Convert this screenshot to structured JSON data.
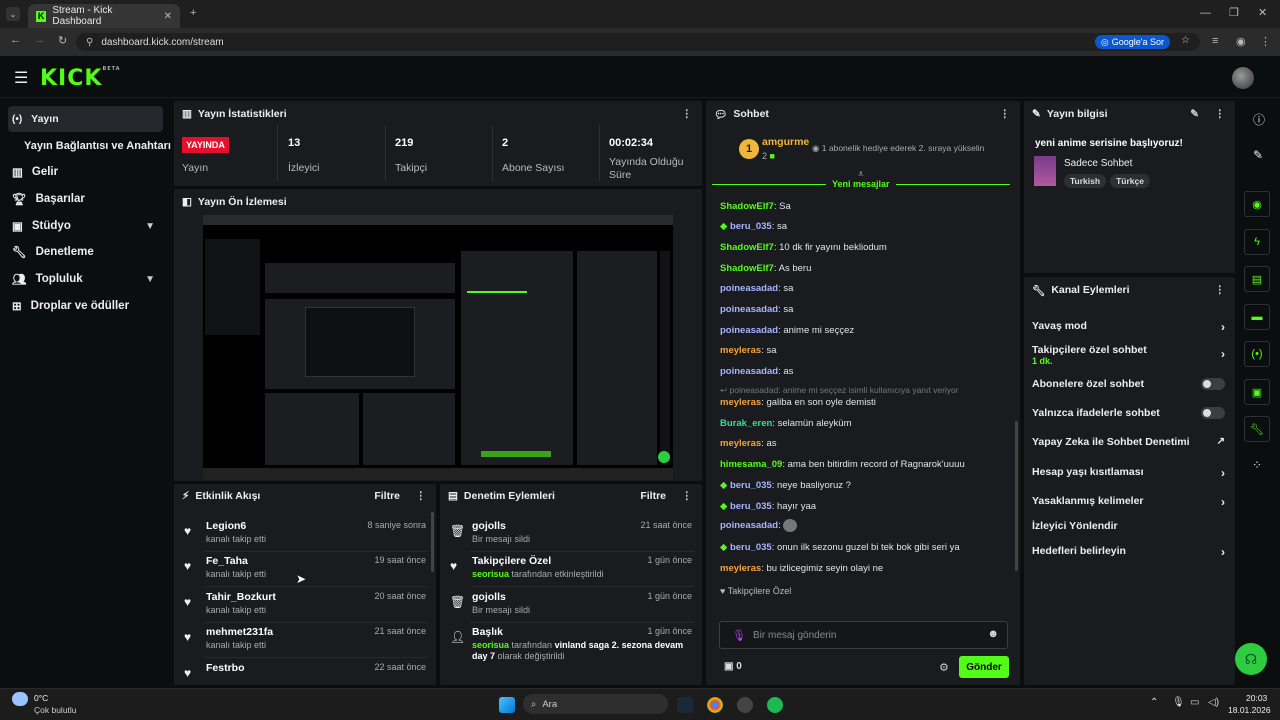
{
  "browser": {
    "tab_title": "Stream - Kick Dashboard",
    "url": "dashboard.kick.com/stream",
    "google_btn": "Google'a Sor"
  },
  "header": {
    "logo": "KICK",
    "beta": "BETA"
  },
  "sidebar": {
    "items": [
      {
        "label": "Yayın",
        "icon": "broadcast-icon"
      },
      {
        "label": "Yayın Bağlantısı ve Anahtarı",
        "icon": ""
      },
      {
        "label": "Gelir",
        "icon": "chart-icon"
      },
      {
        "label": "Başarılar",
        "icon": "trophy-icon"
      },
      {
        "label": "Stüdyo",
        "icon": "studio-icon"
      },
      {
        "label": "Denetleme",
        "icon": "wrench-icon"
      },
      {
        "label": "Topluluk",
        "icon": "people-icon"
      },
      {
        "label": "Droplar ve ödüller",
        "icon": "gift-icon"
      }
    ]
  },
  "stats": {
    "title": "Yayın İstatistikleri",
    "badge": "YAYINDA",
    "status_label": "Yayın",
    "items": [
      {
        "value": "13",
        "label": "İzleyici"
      },
      {
        "value": "219",
        "label": "Takipçi"
      },
      {
        "value": "2",
        "label": "Abone Sayısı"
      },
      {
        "value": "00:02:34",
        "label": "Yayında Olduğu Süre"
      }
    ]
  },
  "preview": {
    "title": "Yayın Ön İzlemesi"
  },
  "activity": {
    "title": "Etkinlik Akışı",
    "filter": "Filtre",
    "rows": [
      {
        "name": "Legion6",
        "sub": "kanalı takip etti",
        "time": "8 saniye sonra"
      },
      {
        "name": "Fe_Taha",
        "sub": "kanalı takip etti",
        "time": "19 saat önce"
      },
      {
        "name": "Tahir_Bozkurt",
        "sub": "kanalı takip etti",
        "time": "20 saat önce"
      },
      {
        "name": "mehmet231fa",
        "sub": "kanalı takip etti",
        "time": "21 saat önce"
      },
      {
        "name": "Festrbo",
        "sub": "",
        "time": "22 saat önce"
      }
    ]
  },
  "moderation": {
    "title": "Denetim Eylemleri",
    "filter": "Filtre",
    "rows": [
      {
        "name": "gojolls",
        "sub_user": "",
        "sub": "Bir mesajı sildi",
        "time": "21 saat önce"
      },
      {
        "name": "Takipçilere Özel",
        "sub_user": "seorisua",
        "sub": " tarafından etkinleştirildi",
        "time": "1 gün önce"
      },
      {
        "name": "gojolls",
        "sub_user": "",
        "sub": "Bir mesajı sildi",
        "time": "1 gün önce"
      },
      {
        "name": "Başlık",
        "sub_user": "seorisua",
        "sub": " tarafından ",
        "sub_bold": "vinland saga 2. sezona devam day 7",
        "sub2": "olarak değiştirildi",
        "time": "1 gün önce"
      }
    ]
  },
  "chat": {
    "title": "Sohbet",
    "top_user": "amgurme",
    "top_rank": "1",
    "top_count": "2",
    "top_note": "1 abonelik hediye ederek 2. sıraya yükselin",
    "new_messages": "Yeni mesajlar",
    "messages": [
      {
        "user": "ShadowElf7",
        "text": "Sa",
        "color": "n1"
      },
      {
        "user": "beru_035",
        "text": "sa",
        "color": "n2"
      },
      {
        "user": "ShadowElf7",
        "text": "10 dk fir yayını bekliodum",
        "color": "n1"
      },
      {
        "user": "ShadowElf7",
        "text": "As beru",
        "color": "n1"
      },
      {
        "user": "poineasadad",
        "text": "sa",
        "color": "n1"
      },
      {
        "user": "poineasadad",
        "text": "sa",
        "color": "n1"
      },
      {
        "user": "poineasadad",
        "text": "anime mi seççez",
        "color": "n1"
      },
      {
        "user": "meyleras",
        "text": "sa",
        "color": "n3"
      },
      {
        "user": "poineasadad",
        "text": "as",
        "color": "n1"
      },
      {
        "user": "meyleras",
        "text": "galiba en son oyle demisti",
        "color": "n3"
      },
      {
        "user": "Burak_eren",
        "text": "selamün aleyküm",
        "color": "n2"
      },
      {
        "user": "meyleras",
        "text": "as",
        "color": "n3"
      },
      {
        "user": "himesama_09",
        "text": "ama ben bitirdim record of Ragnarok'uuuu",
        "color": "n2"
      },
      {
        "user": "beru_035",
        "text": "neye basliyoruz ?",
        "color": "n2"
      },
      {
        "user": "beru_035",
        "text": "hayır yaa",
        "color": "n2"
      },
      {
        "user": "poineasadad",
        "text": "",
        "color": "n1"
      },
      {
        "user": "beru_035",
        "text": "onun ilk sezonu guzel bi tek bok gibi seri ya",
        "color": "n2"
      },
      {
        "user": "meyleras",
        "text": "bu izlicegimiz seyin olayi ne",
        "color": "n3"
      }
    ],
    "reply_note": "poineasadad: anime mi seççez isimli kullanıcıya yanıt veriyor",
    "followers_only": "Takipçilere Özel",
    "input_placeholder": "Bir mesaj gönderin",
    "points": "0",
    "send": "Gönder"
  },
  "stream_info": {
    "title": "Yayın bilgisi",
    "stream_title": "yeni anime serisine başlıyoruz!",
    "category": "Sadece Sohbet",
    "tags": [
      "Turkish",
      "Türkçe"
    ]
  },
  "channel_actions": {
    "title": "Kanal Eylemleri",
    "items": [
      {
        "label": "Yavaş mod",
        "sub": "",
        "ctl": "arrow"
      },
      {
        "label": "Takipçilere özel sohbet",
        "sub": "1 dk.",
        "ctl": "arrow"
      },
      {
        "label": "Abonelere özel sohbet",
        "sub": "",
        "ctl": "toggle"
      },
      {
        "label": "Yalnızca ifadelerle sohbet",
        "sub": "",
        "ctl": "toggle"
      },
      {
        "label": "Yapay Zeka ile Sohbet Denetimi",
        "sub": "",
        "ctl": "ext"
      },
      {
        "label": "Hesap yaşı kısıtlaması",
        "sub": "",
        "ctl": "arrow"
      },
      {
        "label": "Yasaklanmış kelimeler",
        "sub": "",
        "ctl": "arrow"
      },
      {
        "label": "İzleyici Yönlendir",
        "sub": "",
        "ctl": "none"
      },
      {
        "label": "Hedefleri belirleyin",
        "sub": "",
        "ctl": "arrow"
      }
    ]
  },
  "taskbar": {
    "weather_temp": "0°C",
    "weather_desc": "Çok bulutlu",
    "search": "Ara",
    "time": "20:03",
    "date": "18.01.2026"
  }
}
